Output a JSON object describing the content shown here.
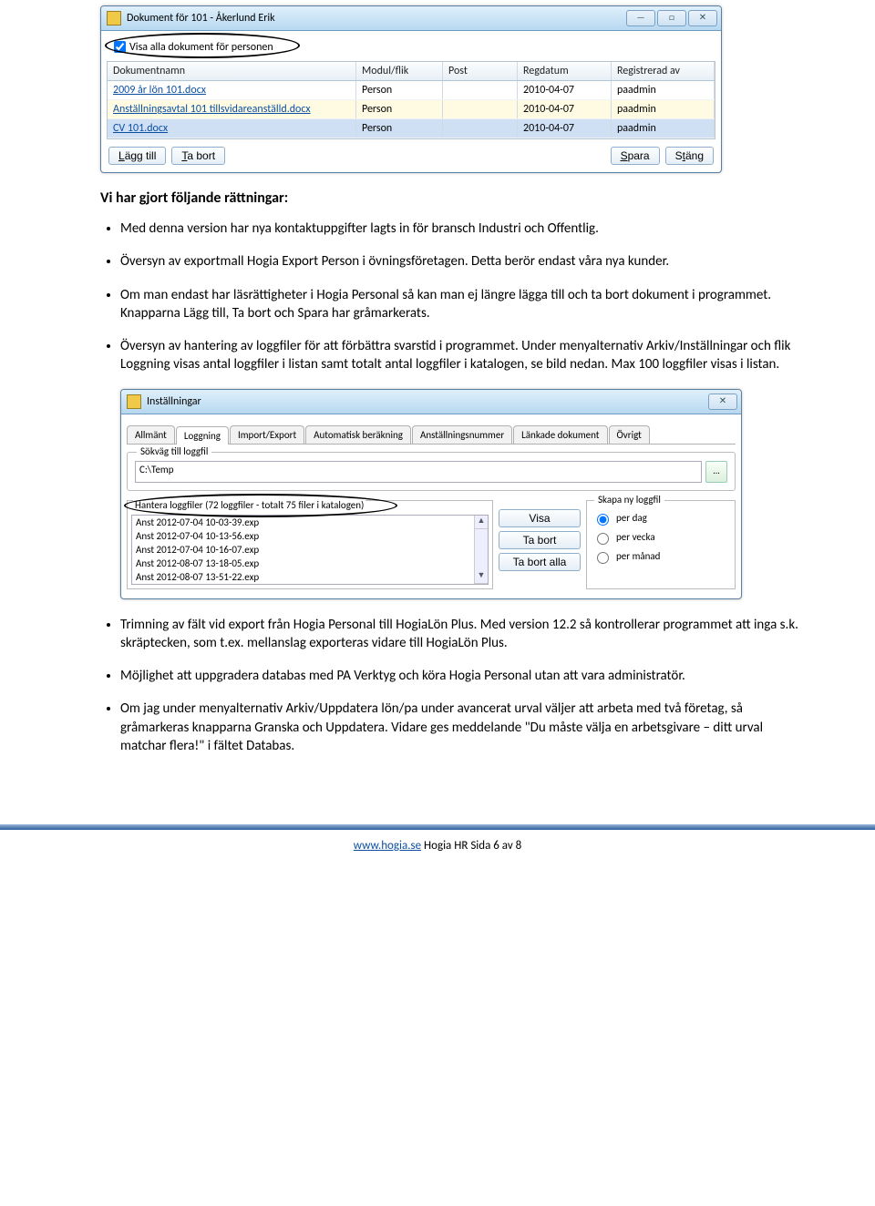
{
  "win1": {
    "title": "Dokument för 101 - Åkerlund Erik",
    "checkbox": "Visa alla dokument för personen",
    "headers": {
      "doc": "Dokumentnamn",
      "mod": "Modul/flik",
      "post": "Post",
      "reg": "Regdatum",
      "by": "Registrerad av"
    },
    "rows": [
      {
        "doc": "2009 år lön 101.docx",
        "mod": "Person",
        "post": "",
        "reg": "2010-04-07",
        "by": "paadmin"
      },
      {
        "doc": "Anställningsavtal 101 tillsvidareanställd.docx",
        "mod": "Person",
        "post": "",
        "reg": "2010-04-07",
        "by": "paadmin"
      },
      {
        "doc": "CV 101.docx",
        "mod": "Person",
        "post": "",
        "reg": "2010-04-07",
        "by": "paadmin"
      }
    ],
    "btns": {
      "add": "Lägg till",
      "remove": "Ta bort",
      "save": "Spara",
      "close": "Stäng"
    }
  },
  "heading": "Vi har gjort följande rättningar:",
  "bullets": {
    "b1": "Med denna version har nya kontaktuppgifter lagts in för bransch Industri och Offentlig.",
    "b2": "Översyn av exportmall Hogia Export Person i övningsföretagen. Detta berör endast våra nya kunder.",
    "b3": "Om man endast har läsrättigheter i Hogia Personal så kan man ej längre lägga till och ta bort dokument i programmet. Knapparna Lägg till, Ta bort och Spara har gråmarkerats.",
    "b4": "Översyn av hantering av loggfiler för att förbättra svarstid i programmet. Under menyalternativ Arkiv/Inställningar och flik Loggning visas antal loggfiler i listan samt totalt antal loggfiler i katalogen, se bild nedan. Max 100 loggfiler visas i listan.",
    "b5": "Trimning av fält vid export från Hogia Personal till HogiaLön Plus. Med version 12.2 så kontrollerar programmet att inga s.k. skräptecken, som t.ex. mellanslag exporteras vidare till HogiaLön Plus.",
    "b6": "Möjlighet att uppgradera databas med PA Verktyg och köra Hogia Personal utan att vara administratör.",
    "b7": "Om jag under menyalternativ Arkiv/Uppdatera lön/pa under avancerat urval väljer att arbeta med två företag, så gråmarkeras knapparna Granska och Uppdatera. Vidare ges meddelande \"Du måste välja en arbetsgivare – ditt urval matchar flera!\" i fältet Databas."
  },
  "win2": {
    "title": "Inställningar",
    "tabs": [
      "Allmänt",
      "Loggning",
      "Import/Export",
      "Automatisk beräkning",
      "Anställningsnummer",
      "Länkade dokument",
      "Övrigt"
    ],
    "pathlegend": "Sökväg till loggfil",
    "path": "C:\\Temp",
    "browse": "...",
    "listlegend": "Hantera loggfiler (72 loggfiler - totalt 75 filer i katalogen)",
    "files": [
      "Anst 2012-07-04 10-03-39.exp",
      "Anst 2012-07-04 10-13-56.exp",
      "Anst 2012-07-04 10-16-07.exp",
      "Anst 2012-08-07 13-18-05.exp",
      "Anst 2012-08-07 13-51-22.exp"
    ],
    "midbtns": {
      "show": "Visa",
      "del": "Ta bort",
      "delall": "Ta bort alla"
    },
    "radiolegend": "Skapa ny loggfil",
    "radios": {
      "day": "per dag",
      "week": "per vecka",
      "month": "per månad"
    }
  },
  "footer": {
    "link": "www.hogia.se",
    "rest": "   Hogia HR  Sida 6 av 8"
  }
}
